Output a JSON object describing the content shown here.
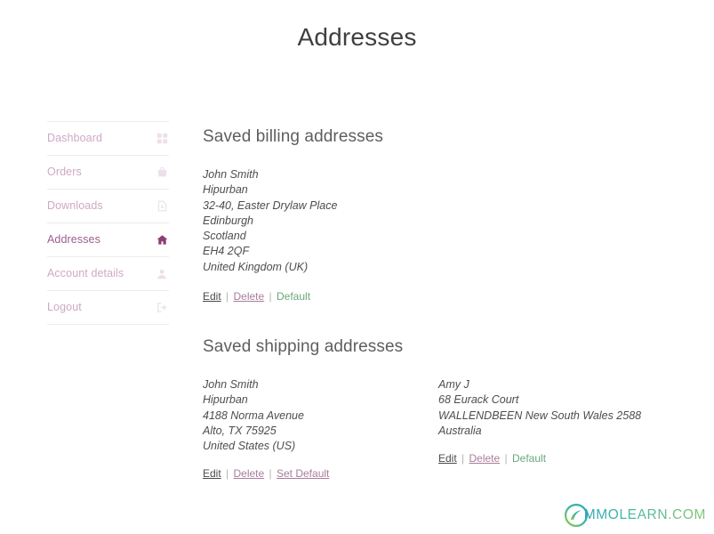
{
  "page": {
    "title": "Addresses"
  },
  "sidebar": {
    "items": [
      {
        "label": "Dashboard",
        "icon": "dashboard-icon",
        "active": false
      },
      {
        "label": "Orders",
        "icon": "orders-bag-icon",
        "active": false
      },
      {
        "label": "Downloads",
        "icon": "download-file-icon",
        "active": false
      },
      {
        "label": "Addresses",
        "icon": "home-icon",
        "active": true
      },
      {
        "label": "Account details",
        "icon": "user-icon",
        "active": false
      },
      {
        "label": "Logout",
        "icon": "sign-out-icon",
        "active": false
      }
    ]
  },
  "billing": {
    "heading": "Saved billing addresses",
    "address": [
      "John Smith",
      "Hipurban",
      "32-40, Easter Drylaw Place",
      "Edinburgh",
      "Scotland",
      "EH4 2QF",
      "United Kingdom (UK)"
    ],
    "actions": {
      "edit": "Edit",
      "delete": "Delete",
      "default": "Default",
      "separator": "|"
    }
  },
  "shipping": {
    "heading": "Saved shipping addresses",
    "entries": [
      {
        "address": [
          "John Smith",
          "Hipurban",
          "4188 Norma Avenue",
          "Alto, TX 75925",
          "United States (US)"
        ],
        "actions": {
          "edit": "Edit",
          "delete": "Delete",
          "default": "Set Default",
          "separator": "|"
        }
      },
      {
        "address": [
          "Amy J",
          "68 Eurack Court",
          "WALLENDBEEN New South Wales 2588",
          "Australia"
        ],
        "actions": {
          "edit": "Edit",
          "delete": "Delete",
          "default": "Default",
          "separator": "|"
        }
      }
    ]
  },
  "watermark": {
    "text": "MMOLEARN.COM",
    "icon": "mmolearn-circle-logo"
  },
  "colors": {
    "accent_active": "#8e3d76",
    "nav_link": "#cfa9c4",
    "default_green": "#68a97a",
    "heading": "#5e5e5e",
    "divider": "#ececec"
  }
}
